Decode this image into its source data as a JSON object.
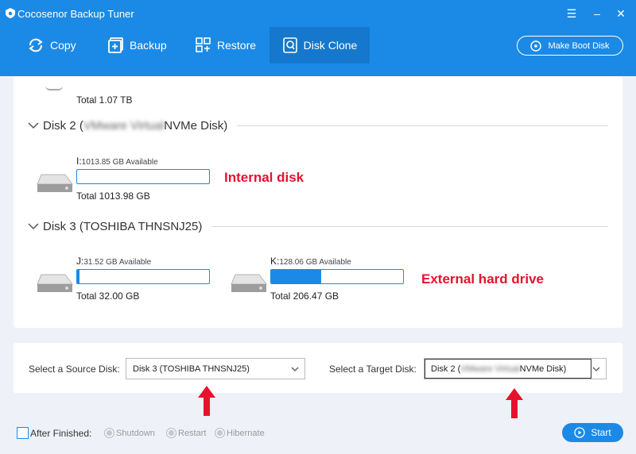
{
  "app": {
    "title": "Cocosenor Backup Tuner"
  },
  "tabs": [
    {
      "label": "Copy"
    },
    {
      "label": "Backup"
    },
    {
      "label": "Restore"
    },
    {
      "label": "Disk Clone"
    }
  ],
  "make_boot_disk_label": "Make Boot Disk",
  "disks": {
    "top_total": "Total 1.07 TB",
    "disk2": {
      "title_prefix": "Disk 2 (",
      "title_blurred": "VMware Virtual",
      "title_suffix": " NVMe Disk)",
      "drives": [
        {
          "letter": "I:",
          "available": "1013.85 GB Available",
          "total": "Total 1013.98 GB",
          "used_fraction": 0.0
        }
      ]
    },
    "disk3": {
      "title": "Disk 3 (TOSHIBA THNSNJ25)",
      "drives": [
        {
          "letter": "J:",
          "available": "31.52 GB Available",
          "total": "Total 32.00 GB",
          "used_fraction": 0.02
        },
        {
          "letter": "K:",
          "available": "128.06 GB Available",
          "total": "Total 206.47 GB",
          "used_fraction": 0.38
        }
      ]
    }
  },
  "annotations": {
    "internal": "Internal disk",
    "external": "External hard drive"
  },
  "selectors": {
    "source_label": "Select a Source Disk:",
    "source_value": "Disk 3 (TOSHIBA THNSNJ25)",
    "target_label": "Select a Target Disk:",
    "target_prefix": "Disk 2 (",
    "target_blurred": "VMware Virtual",
    "target_suffix": " NVMe Disk)"
  },
  "footer": {
    "after_finished": "After Finished:",
    "options": [
      "Shutdown",
      "Restart",
      "Hibernate"
    ],
    "start_label": "Start"
  },
  "colors": {
    "accent": "#1b8ae6",
    "annotation": "#e8112d"
  }
}
